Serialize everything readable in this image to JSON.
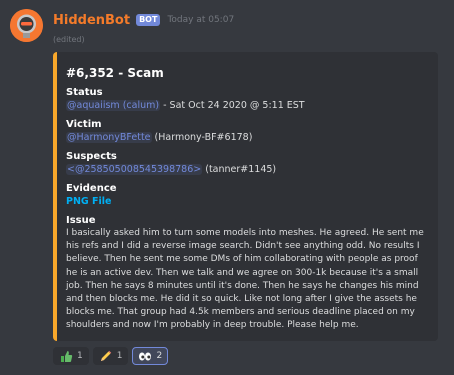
{
  "message": {
    "username": "HiddenBot",
    "bot_tag": "BOT",
    "timestamp": "Today at 05:07",
    "edited": "(edited)"
  },
  "embed": {
    "accent_color": "#f9a82b",
    "title": "#6,352 - Scam",
    "status": {
      "name": "Status",
      "mention": "@aquaiism (calum)",
      "text": " - Sat Oct 24 2020 @ 5:11 EST"
    },
    "victim": {
      "name": "Victim",
      "mention": "@HarmonyBFette",
      "text": " (Harmony-BF#6178)"
    },
    "suspects": {
      "name": "Suspects",
      "mention": "<@258505008545398786>",
      "text": " (tanner#1145)"
    },
    "evidence": {
      "name": "Evidence",
      "link": "PNG File"
    },
    "issue": {
      "name": "Issue",
      "text": "I basically asked him to turn some models into meshes. He agreed. He sent me his refs and I did a reverse image search. Didn't see anything odd. No results I believe. Then he sent me some DMs of him collaborating with people as proof he is an active dev. Then we talk and we agree on 300-1k because it's a small job. Then he says 8 minutes until it's done. Then he says he changes his mind and then blocks me. He did it so quick. Like not long after I give the assets he blocks me. That group had 4.5k members and serious deadline placed on my shoulders and now I'm probably in deep trouble. Please help me."
    }
  },
  "reactions": [
    {
      "icon": "thumbs-up-icon",
      "count": "1"
    },
    {
      "icon": "pencil-icon",
      "count": "1"
    },
    {
      "icon": "eye-icon",
      "count": "2"
    }
  ]
}
